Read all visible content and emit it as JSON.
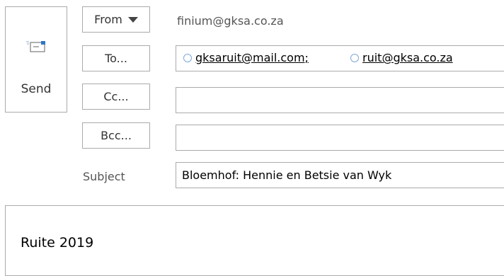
{
  "send": {
    "label": "Send",
    "icon": "send-envelope-icon"
  },
  "header": {
    "from_label": "From",
    "from_value": "finium@gksa.co.za",
    "to_label": "To...",
    "cc_label": "Cc...",
    "bcc_label": "Bcc...",
    "subject_label": "Subject"
  },
  "to": {
    "recipients": [
      {
        "name": "gksaruit@mail.com",
        "separator": ";"
      },
      {
        "name": "ruit@gksa.co.za",
        "separator": ""
      }
    ]
  },
  "cc": {
    "value": ""
  },
  "bcc": {
    "value": ""
  },
  "subject": {
    "value": "Bloemhof: Hennie en Betsie van Wyk"
  },
  "body": {
    "text": "Ruite 2019"
  },
  "colors": {
    "border": "#ababab",
    "recipient_icon": "#7fa7d8",
    "label_text": "#555555"
  }
}
